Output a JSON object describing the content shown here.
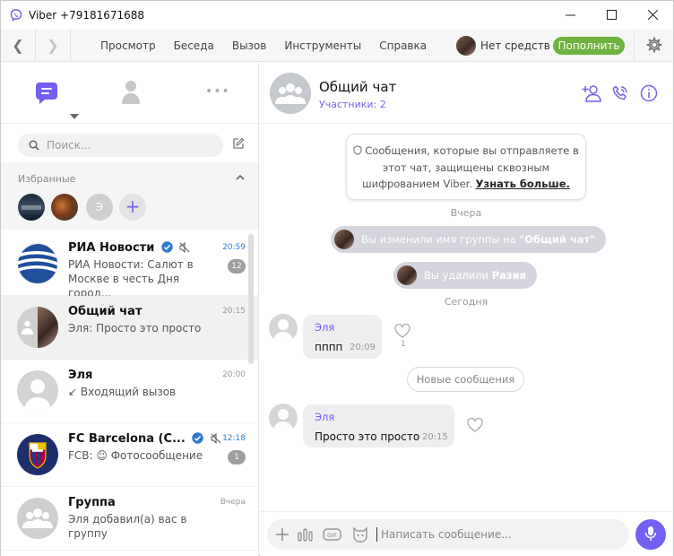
{
  "window": {
    "title": "Viber +79181671688"
  },
  "menu": {
    "items": [
      "Просмотр",
      "Беседа",
      "Вызов",
      "Инструменты",
      "Справка"
    ],
    "funds_label": "Нет средств",
    "topup_label": "Пополнить"
  },
  "left": {
    "more_label": "•••",
    "search_placeholder": "Поиск...",
    "favorites_title": "Избранные",
    "favorites_letter": "Э",
    "favorites_add": "+",
    "chats": [
      {
        "name": "РИА Новости",
        "preview": "РИА Новости: Салют в Москве в честь Дня город...",
        "time": "20:59",
        "badge": "12",
        "verified": true,
        "muted": true,
        "time_color": "#2d7bd1"
      },
      {
        "name": "Общий чат",
        "preview": "Эля: Просто это просто",
        "time": "20:15"
      },
      {
        "name": "Эля",
        "preview": "↙ Входящий вызов",
        "time": "20:00"
      },
      {
        "name": "FC Barcelona (C...",
        "preview": "FCB: ☺ Фотосообщение",
        "time": "12:18",
        "badge": "1",
        "verified": true,
        "muted": true,
        "time_color": "#2d7bd1"
      },
      {
        "name": "Группа",
        "preview": "Эля добавил(а) вас в группу",
        "time": "Вчера"
      }
    ]
  },
  "chat": {
    "title": "Общий чат",
    "subtitle": "Участники: 2",
    "encryption_text": "Сообщения, которые вы отправляете в этот чат, защищены сквозным шифрованием Viber.",
    "encryption_link": "Узнать больше.",
    "day_yesterday": "Вчера",
    "day_today": "Сегодня",
    "sys1_text": "Вы изменили имя группы на ",
    "sys1_bold": "\"Общий чат\"",
    "sys2_text": "Вы удалили ",
    "sys2_bold": "Разия",
    "msg1": {
      "sender": "Эля",
      "text": "пппп",
      "time": "20:09",
      "likes": "1"
    },
    "new_messages": "Новые сообщения",
    "msg2": {
      "sender": "Эля",
      "text": "Просто это просто",
      "time": "20:15"
    },
    "input_placeholder": "Написать сообщение..."
  },
  "colors": {
    "accent": "#7360f2",
    "topup": "#6cb33f",
    "verified": "#2d7bd1"
  }
}
